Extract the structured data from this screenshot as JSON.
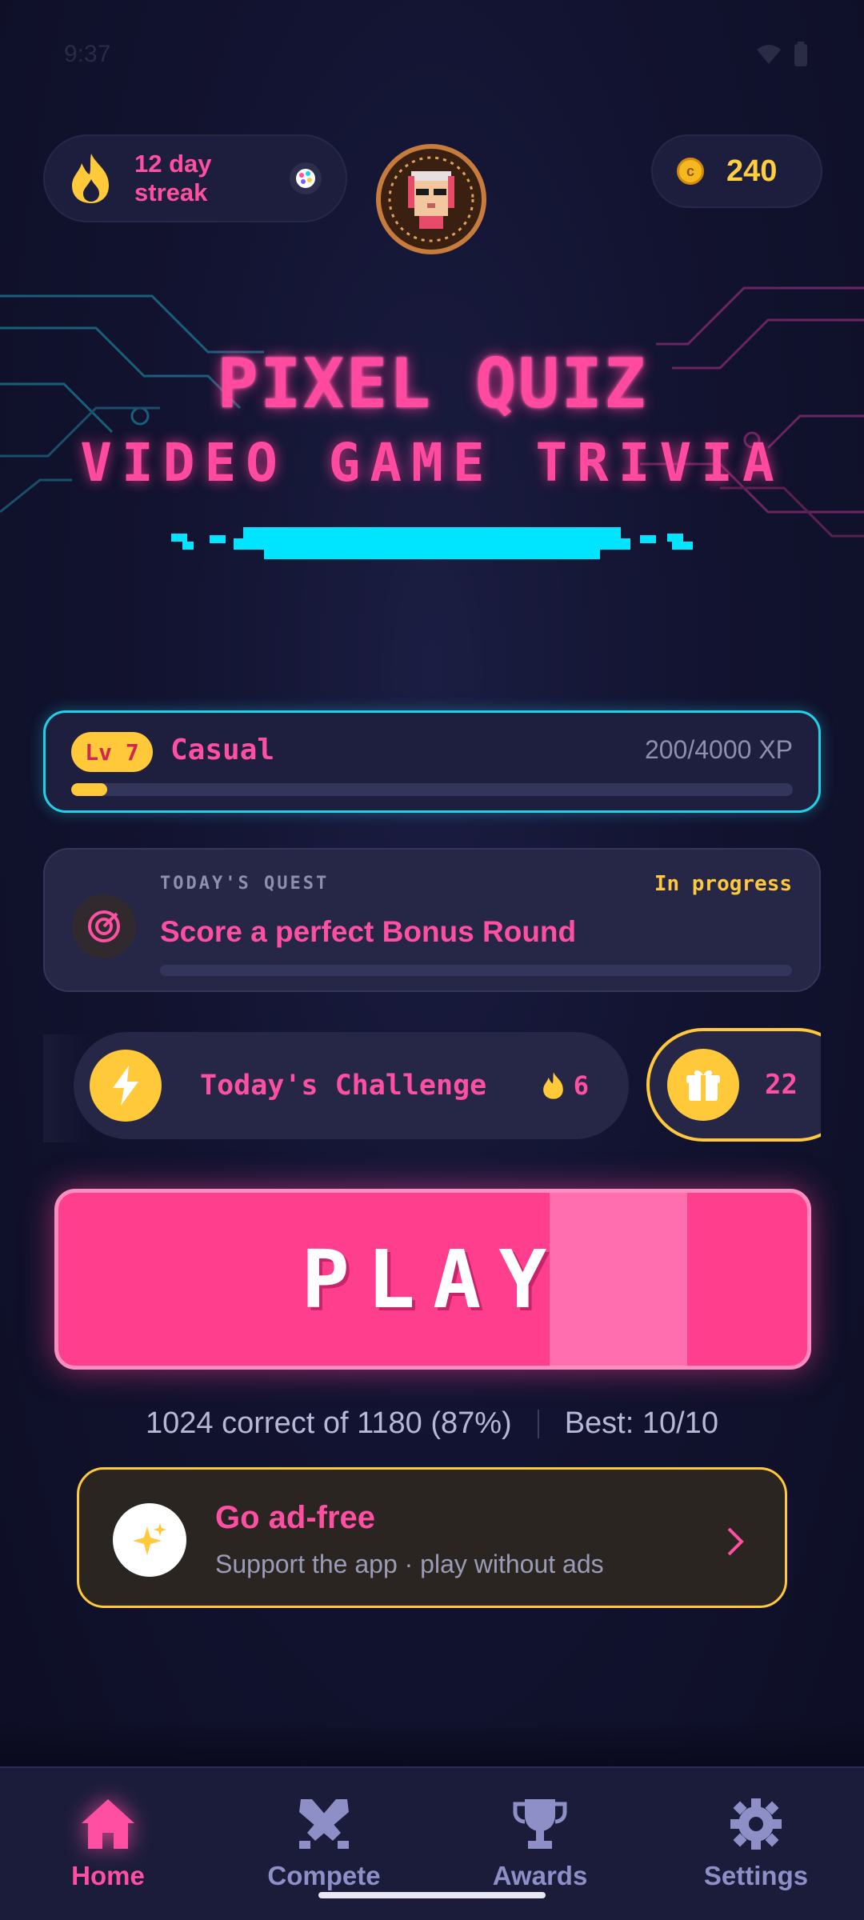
{
  "status_bar": {
    "time": "9:37"
  },
  "streak": {
    "text": "12 day streak"
  },
  "coins": {
    "count": "240"
  },
  "title": {
    "line1": "PIXEL QUIZ",
    "line2": "VIDEO GAME TRIVIA"
  },
  "level": {
    "badge": "Lv 7",
    "name": "Casual",
    "xp_text": "200/4000 XP",
    "progress": 0.05
  },
  "quest": {
    "label": "TODAY'S QUEST",
    "status": "In progress",
    "text": "Score a perfect Bonus Round",
    "progress": 0
  },
  "challenge": {
    "label": "Today's Challenge",
    "count": "6"
  },
  "gift": {
    "count": "22"
  },
  "play": {
    "label": "PLAY"
  },
  "stats": {
    "correct": "1024 correct of 1180 (87%)",
    "best": "Best: 10/10"
  },
  "adfree": {
    "title": "Go ad-free",
    "subtitle": "Support the app · play without ads"
  },
  "nav": {
    "items": [
      {
        "label": "Home",
        "active": true
      },
      {
        "label": "Compete",
        "active": false
      },
      {
        "label": "Awards",
        "active": false
      },
      {
        "label": "Settings",
        "active": false
      }
    ]
  },
  "colors": {
    "accent_pink": "#ff4fa3",
    "accent_yellow": "#ffc93a",
    "accent_cyan": "#1fd0e8",
    "background": "#0f1028"
  }
}
